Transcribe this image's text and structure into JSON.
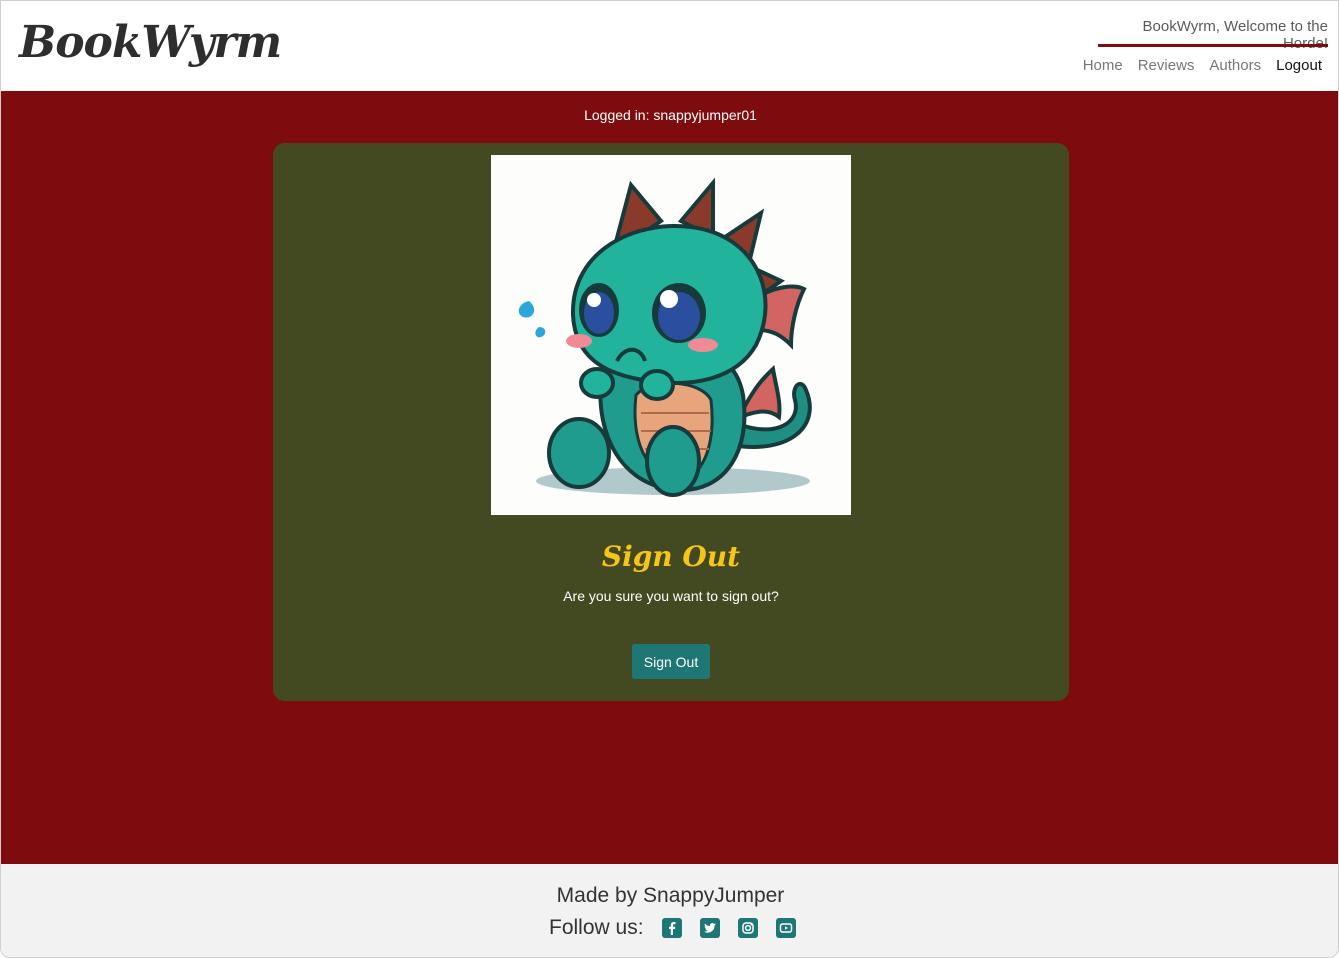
{
  "header": {
    "brand": "BookWyrm",
    "welcome": "BookWyrm, Welcome to the Horde!",
    "nav": [
      {
        "label": "Home"
      },
      {
        "label": "Reviews"
      },
      {
        "label": "Authors"
      },
      {
        "label": "Logout"
      }
    ]
  },
  "main": {
    "logged_in": "Logged in: snappyjumper01",
    "card": {
      "image_icon": "sad-dragon-illustration",
      "title": "Sign Out",
      "text": "Are you sure you want to sign out?",
      "button_label": "Sign Out"
    }
  },
  "footer": {
    "made_by": "Made by SnappyJumper",
    "follow_label": "Follow us:",
    "socials": [
      "facebook-icon",
      "twitter-icon",
      "instagram-icon",
      "youtube-icon"
    ]
  },
  "colors": {
    "accent_red": "#7e0c0e",
    "card_olive": "#434a21",
    "button_teal": "#1e7775",
    "title_gold": "#f5c518"
  }
}
